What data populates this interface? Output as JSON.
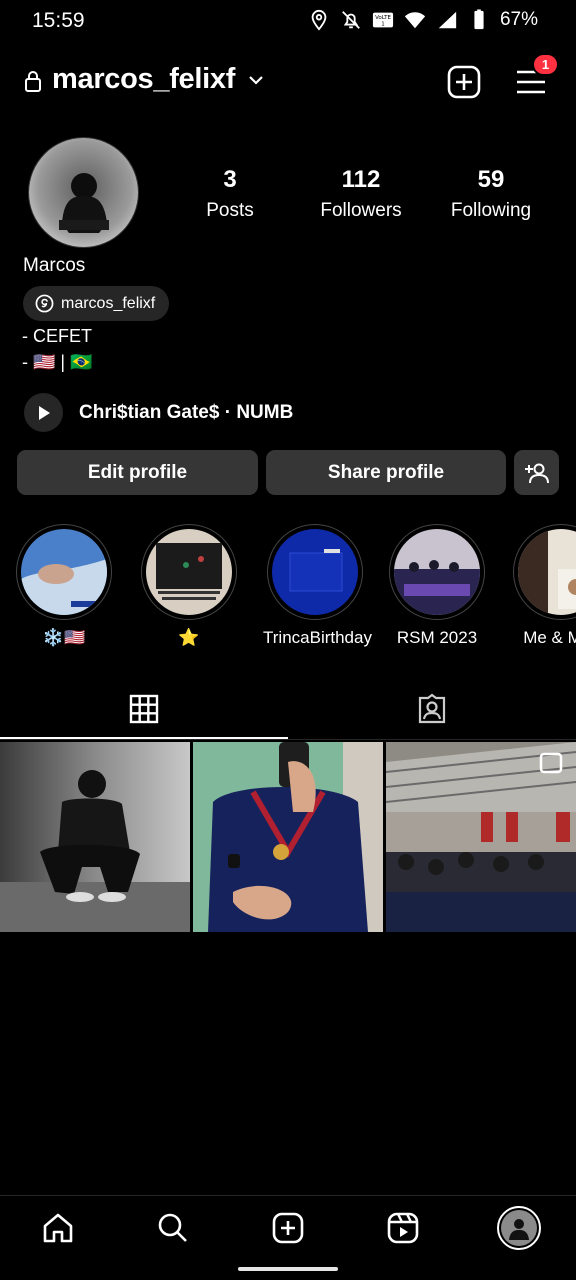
{
  "status_bar": {
    "time": "15:59",
    "battery": "67%",
    "icons": [
      "location-icon",
      "bell-off-icon",
      "volte-icon",
      "wifi-icon",
      "signal-icon",
      "battery-icon"
    ]
  },
  "header": {
    "username": "marcos_felixf",
    "notification_count": "1",
    "icons": [
      "lock-icon",
      "chevron-down-icon",
      "new-post-icon",
      "menu-icon"
    ]
  },
  "profile": {
    "stats": [
      {
        "value": "3",
        "label": "Posts"
      },
      {
        "value": "112",
        "label": "Followers"
      },
      {
        "value": "59",
        "label": "Following"
      }
    ],
    "display_name": "Marcos",
    "threads_handle": "marcos_felixf",
    "bio": [
      "- CEFET",
      "- 🇺🇸 | 🇧🇷"
    ],
    "music": "Chri$tian Gate$ · NUMB"
  },
  "actions": {
    "edit_profile": "Edit profile",
    "share_profile": "Share profile"
  },
  "highlights": [
    {
      "label": "❄️🇺🇸"
    },
    {
      "label": "⭐"
    },
    {
      "label": "TrincaBirthday"
    },
    {
      "label": "RSM 2023"
    },
    {
      "label": "Me & Mys"
    }
  ],
  "tabs": [
    "grid-icon",
    "tagged-icon"
  ],
  "bottom_nav": [
    "home-icon",
    "search-icon",
    "create-icon",
    "reels-icon",
    "profile-avatar"
  ],
  "colors": {
    "background": "#000000",
    "button": "#363636",
    "badge": "#ff3040"
  }
}
